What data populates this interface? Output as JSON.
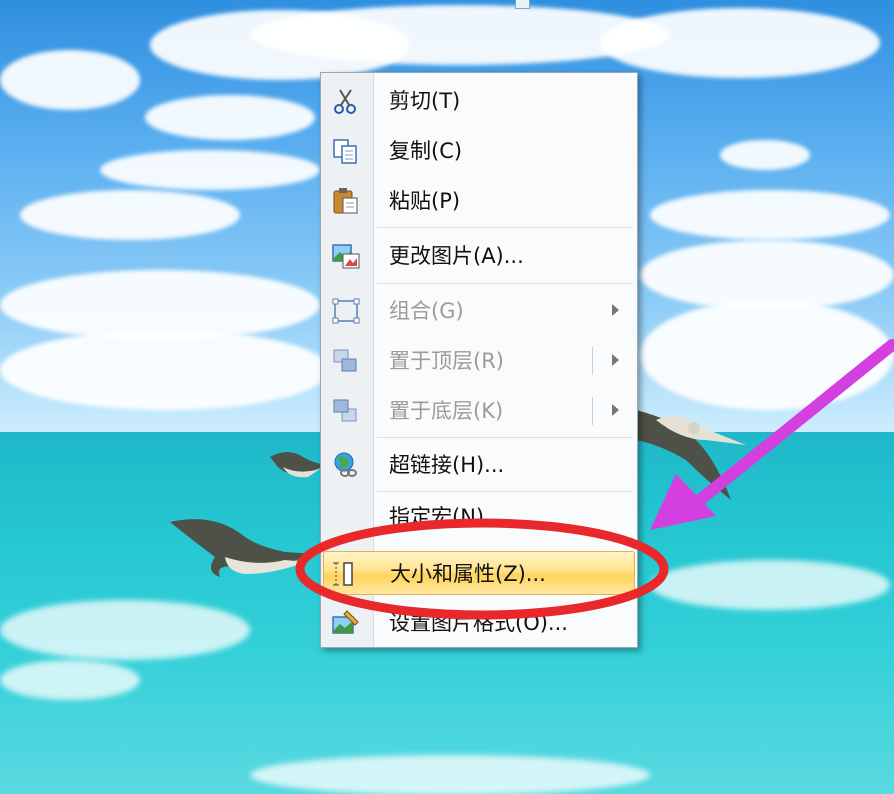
{
  "menu": {
    "items": [
      {
        "label": "剪切(T)",
        "icon": "scissors-icon",
        "enabled": true
      },
      {
        "label": "复制(C)",
        "icon": "copy-icon",
        "enabled": true
      },
      {
        "label": "粘贴(P)",
        "icon": "paste-icon",
        "enabled": true
      },
      {
        "label": "更改图片(A)...",
        "icon": "change-picture-icon",
        "enabled": true
      },
      {
        "label": "组合(G)",
        "icon": "group-icon",
        "enabled": false
      },
      {
        "label": "置于顶层(R)",
        "icon": "bring-to-front-icon",
        "enabled": false
      },
      {
        "label": "置于底层(K)",
        "icon": "send-to-back-icon",
        "enabled": false
      },
      {
        "label": "超链接(H)...",
        "icon": "hyperlink-icon",
        "enabled": true
      },
      {
        "label": "指定宏(N)...",
        "icon": "",
        "enabled": true
      },
      {
        "label": "大小和属性(Z)...",
        "icon": "size-properties-icon",
        "enabled": true,
        "highlighted": true
      },
      {
        "label": "设置图片格式(O)...",
        "icon": "format-picture-icon",
        "enabled": true
      }
    ]
  },
  "colors": {
    "highlight": "#ffd35b",
    "annotation": "#e8282b",
    "arrow": "#d43fe0"
  }
}
